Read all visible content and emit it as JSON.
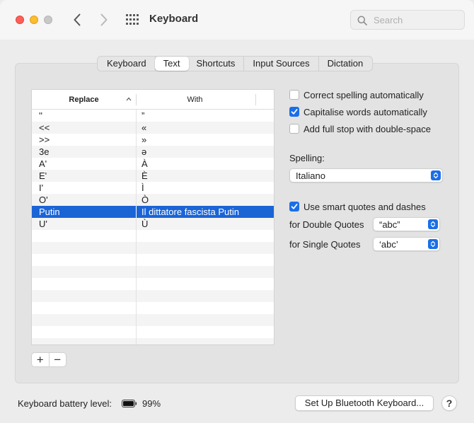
{
  "window": {
    "title": "Keyboard"
  },
  "search": {
    "placeholder": "Search"
  },
  "tabs": [
    {
      "label": "Keyboard",
      "active": false
    },
    {
      "label": "Text",
      "active": true
    },
    {
      "label": "Shortcuts",
      "active": false
    },
    {
      "label": "Input Sources",
      "active": false
    },
    {
      "label": "Dictation",
      "active": false
    }
  ],
  "table": {
    "columns": {
      "replace": "Replace",
      "with": "With"
    },
    "rows": [
      {
        "replace": "''",
        "with": "”",
        "selected": false
      },
      {
        "replace": "<<",
        "with": "«",
        "selected": false
      },
      {
        "replace": ">>",
        "with": "»",
        "selected": false
      },
      {
        "replace": "3e",
        "with": "ə",
        "selected": false
      },
      {
        "replace": "A'",
        "with": "À",
        "selected": false
      },
      {
        "replace": "E'",
        "with": "È",
        "selected": false
      },
      {
        "replace": "I'",
        "with": "Ì",
        "selected": false
      },
      {
        "replace": "O'",
        "with": "Ò",
        "selected": false
      },
      {
        "replace": "Putin",
        "with": "Il dittatore fascista Putin",
        "selected": true
      },
      {
        "replace": "U'",
        "with": "Ù",
        "selected": false
      }
    ],
    "add_label": "+",
    "remove_label": "−"
  },
  "options": {
    "correct_spelling": {
      "label": "Correct spelling automatically",
      "checked": false
    },
    "capitalise": {
      "label": "Capitalise words automatically",
      "checked": true
    },
    "full_stop": {
      "label": "Add full stop with double-space",
      "checked": false
    },
    "spelling_label": "Spelling:",
    "spelling_value": "Italiano",
    "smart_quotes": {
      "label": "Use smart quotes and dashes",
      "checked": true
    },
    "double_quotes_label": "for Double Quotes",
    "double_quotes_value": "“abc”",
    "single_quotes_label": "for Single Quotes",
    "single_quotes_value": "‘abc’"
  },
  "footer": {
    "battery_label": "Keyboard battery level:",
    "battery_percent": "99%",
    "bluetooth_button": "Set Up Bluetooth Keyboard...",
    "help_button": "?"
  },
  "colors": {
    "accent": "#1a6fe8",
    "selection": "#1a64d6"
  },
  "icons": [
    "back-chevron-icon",
    "forward-chevron-icon",
    "grid-icon",
    "search-icon",
    "battery-icon",
    "checkmark-icon",
    "stepper-icon",
    "sort-arrow-icon"
  ]
}
